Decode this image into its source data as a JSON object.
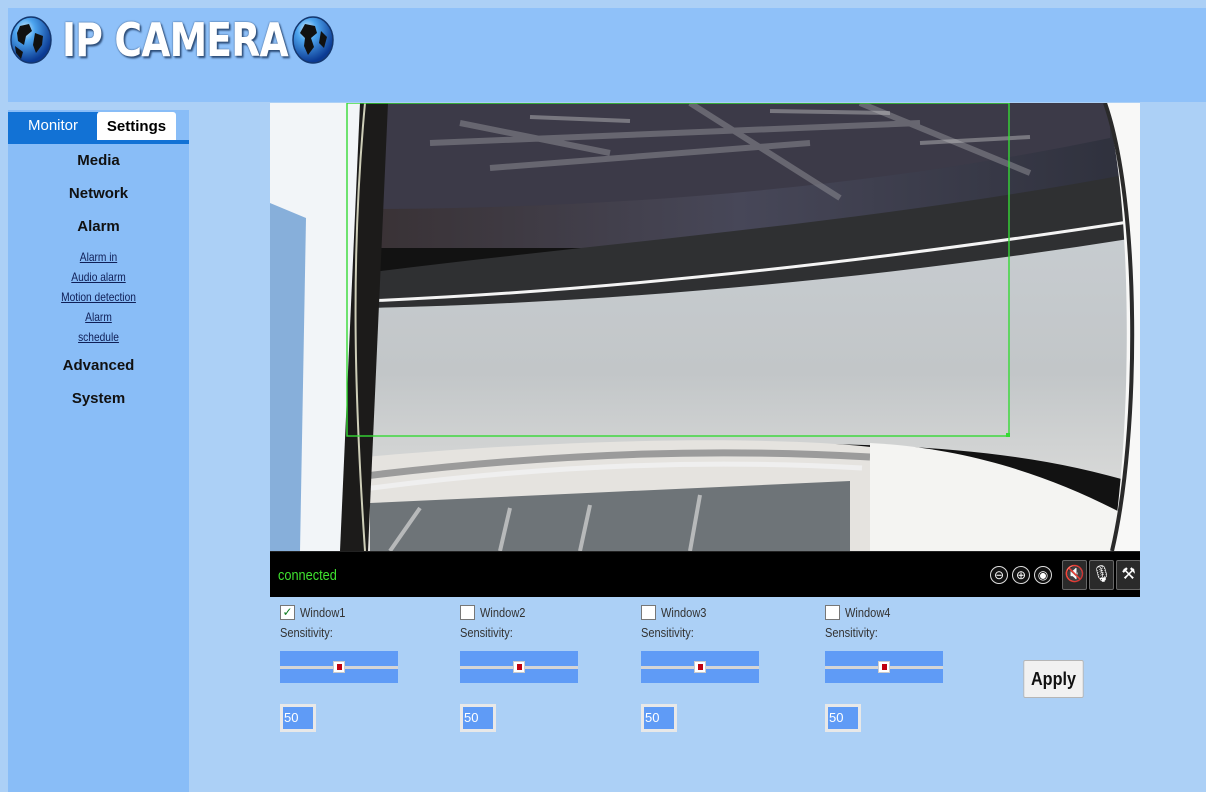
{
  "app": {
    "title": "IP CAMERA",
    "colors": {
      "page_bg": "#acd0f6",
      "header_bg": "#8fc1f9",
      "sidebar_bg": "#89bdf7",
      "tab_accent": "#1272d5",
      "slider_bg": "#5f9bf6",
      "connected_green": "#3fe32f",
      "motion_window_green": "#35d935"
    }
  },
  "tabs": [
    {
      "label": "Monitor",
      "active": false
    },
    {
      "label": "Settings",
      "active": true
    }
  ],
  "menu": {
    "media": "Media",
    "network": "Network",
    "alarm": "Alarm",
    "alarm_sub": [
      "Alarm in",
      "Audio alarm",
      "Motion detection",
      "Alarm",
      "schedule"
    ],
    "advanced": "Advanced",
    "system": "System"
  },
  "video": {
    "status": "connected",
    "controls": {
      "zoom_out": "⊖",
      "zoom_in": "⊕",
      "record": "◉",
      "mute": "🔇",
      "mic": "🎙",
      "settings": "⚒"
    },
    "icons": [
      "zoom-out-icon",
      "zoom-in-icon",
      "record-icon",
      "speaker-mute-icon",
      "microphone-off-icon",
      "tools-icon"
    ]
  },
  "motion": {
    "sensitivity_label": "Sensitivity:",
    "windows": [
      {
        "label": "Window1",
        "checked": true,
        "sensitivity": 50,
        "value": "50"
      },
      {
        "label": "Window2",
        "checked": false,
        "sensitivity": 50,
        "value": "50"
      },
      {
        "label": "Window3",
        "checked": false,
        "sensitivity": 50,
        "value": "50"
      },
      {
        "label": "Window4",
        "checked": false,
        "sensitivity": 50,
        "value": "50"
      }
    ],
    "apply_label": "Apply"
  }
}
